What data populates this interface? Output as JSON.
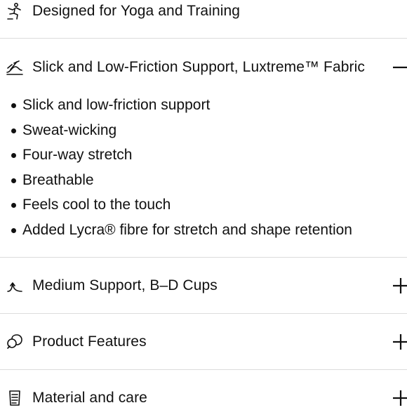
{
  "accordion": {
    "items": [
      {
        "label": "Designed for Yoga and Training",
        "icon": "yoga-pose-icon",
        "state": "collapsed"
      },
      {
        "label": "Slick and Low-Friction Support, Luxtreme™ Fabric",
        "icon": "fabric-glide-icon",
        "state": "expanded"
      },
      {
        "label": "Medium Support, B–D Cups",
        "icon": "support-icon",
        "state": "collapsed"
      },
      {
        "label": "Product Features",
        "icon": "product-features-icon",
        "state": "collapsed"
      },
      {
        "label": "Material and care",
        "icon": "care-label-icon",
        "state": "collapsed"
      }
    ],
    "expanded_details": [
      "Slick and low-friction support",
      "Sweat-wicking",
      "Four-way stretch",
      "Breathable",
      "Feels cool to the touch",
      "Added Lycra® fibre for stretch and shape retention"
    ],
    "expand_symbol": "plus-icon",
    "collapse_symbol": "minus-icon"
  },
  "colors": {
    "text": "#111111",
    "divider": "#dcdcdc",
    "background": "#ffffff"
  }
}
